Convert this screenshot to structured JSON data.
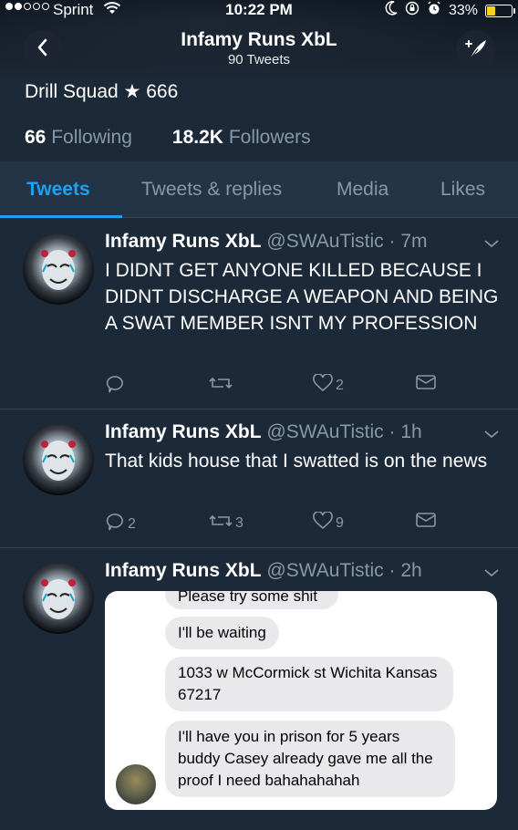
{
  "status_bar": {
    "carrier": "Sprint",
    "time": "10:22 PM",
    "battery": "33%",
    "battery_level": 0.33
  },
  "header": {
    "title": "Infamy Runs XbL",
    "subtitle": "90 Tweets"
  },
  "profile": {
    "bio": "Drill Squad ★ 666",
    "following_count": "66",
    "following_label": "Following",
    "followers_count": "18.2K",
    "followers_label": "Followers"
  },
  "tabs": [
    {
      "label": "Tweets",
      "active": true
    },
    {
      "label": "Tweets & replies",
      "active": false
    },
    {
      "label": "Media",
      "active": false
    },
    {
      "label": "Likes",
      "active": false
    }
  ],
  "tweets": [
    {
      "name": "Infamy Runs XbL",
      "handle": "@SWAuTistic",
      "time": "7m",
      "text": "I DIDNT GET ANYONE KILLED BECAUSE I DIDNT DISCHARGE A WEAPON AND BEING A SWAT MEMBER ISNT MY PROFESSION",
      "replies": "",
      "retweets": "",
      "likes": "2"
    },
    {
      "name": "Infamy Runs XbL",
      "handle": "@SWAuTistic",
      "time": "1h",
      "text": "That kids house that I swatted is on the news",
      "replies": "2",
      "retweets": "3",
      "likes": "9"
    },
    {
      "name": "Infamy Runs XbL",
      "handle": "@SWAuTistic",
      "time": "2h",
      "media_messages": [
        "Please try some shit",
        "I'll be waiting",
        "1033 w McCormick st Wichita Kansas 67217",
        "I'll have you in prison for 5 years buddy Casey already gave me all the proof I need bahahahahah"
      ]
    }
  ],
  "icons": {
    "back": "chevron-left-icon",
    "compose": "compose-feather-icon",
    "reply": "reply-icon",
    "retweet": "retweet-icon",
    "like": "heart-icon",
    "dm": "envelope-icon",
    "caret": "chevron-down-icon"
  },
  "colors": {
    "accent": "#1da1f2",
    "background": "#1c2938",
    "tab_bar": "#243447",
    "muted": "#8899a6",
    "battery": "#f7d21b"
  }
}
